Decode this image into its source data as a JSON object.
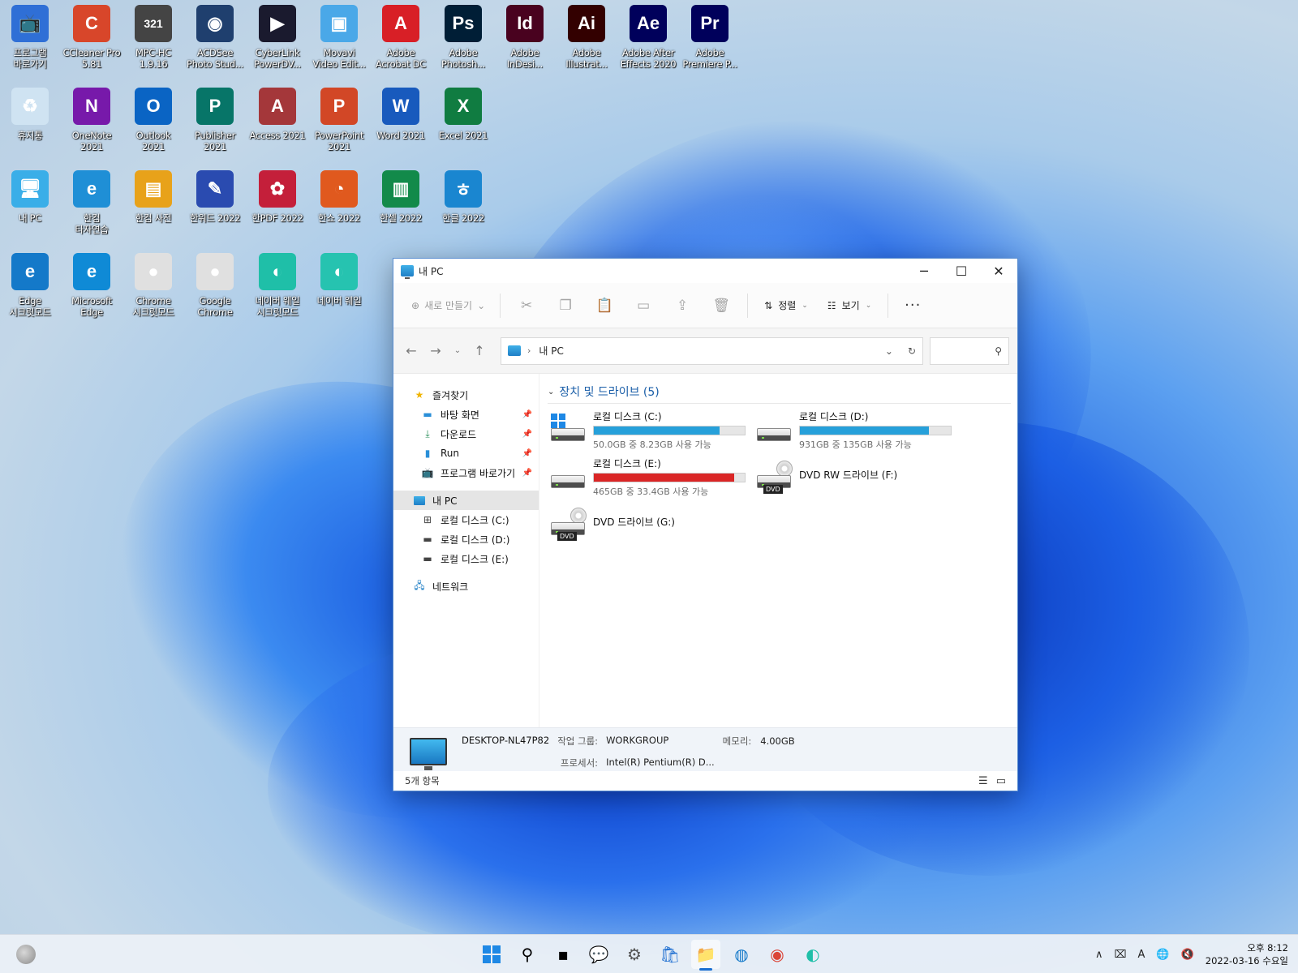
{
  "desktop": {
    "icons": [
      {
        "label": "프로그램\n바로가기",
        "glyph": "📺",
        "bg": "#2f6fd6"
      },
      {
        "label": "CCleaner Pro\n5.81",
        "glyph": "C",
        "bg": "#d8462a"
      },
      {
        "label": "MPC-HC\n1.9.16",
        "glyph": "321",
        "bg": "#444444"
      },
      {
        "label": "ACDSee\nPhoto Stud...",
        "glyph": "◉",
        "bg": "#1f3f6e"
      },
      {
        "label": "CyberLink\nPowerDV...",
        "glyph": "▶",
        "bg": "#1a1a2e"
      },
      {
        "label": "Movavi\nVideo Edit...",
        "glyph": "▣",
        "bg": "#4aa8e8"
      },
      {
        "label": "Adobe\nAcrobat DC",
        "glyph": "A",
        "bg": "#d81f26"
      },
      {
        "label": "Adobe\nPhotosh...",
        "glyph": "Ps",
        "bg": "#001e36"
      },
      {
        "label": "Adobe\nInDesi...",
        "glyph": "Id",
        "bg": "#49021f"
      },
      {
        "label": "Adobe\nIllustrat...",
        "glyph": "Ai",
        "bg": "#330000"
      },
      {
        "label": "Adobe After\nEffects 2020",
        "glyph": "Ae",
        "bg": "#00005b"
      },
      {
        "label": "Adobe\nPremiere P...",
        "glyph": "Pr",
        "bg": "#00005b"
      },
      {
        "label": "휴지통",
        "glyph": "♻",
        "bg": "#cfe3f2"
      },
      {
        "label": "OneNote\n2021",
        "glyph": "N",
        "bg": "#7719aa"
      },
      {
        "label": "Outlook\n2021",
        "glyph": "O",
        "bg": "#0a64c4"
      },
      {
        "label": "Publisher\n2021",
        "glyph": "P",
        "bg": "#077568"
      },
      {
        "label": "Access 2021",
        "glyph": "A",
        "bg": "#a4373a"
      },
      {
        "label": "PowerPoint\n2021",
        "glyph": "P",
        "bg": "#d24726"
      },
      {
        "label": "Word 2021",
        "glyph": "W",
        "bg": "#185abd"
      },
      {
        "label": "Excel 2021",
        "glyph": "X",
        "bg": "#107c41"
      },
      {
        "label": "내 PC",
        "glyph": "🖥",
        "bg": "#3aaee8"
      },
      {
        "label": "한컴\n타자연습",
        "glyph": "e",
        "bg": "#1f8fd6"
      },
      {
        "label": "한컴 사전",
        "glyph": "▤",
        "bg": "#e8a21a"
      },
      {
        "label": "한워드 2022",
        "glyph": "✎",
        "bg": "#2a4bb0"
      },
      {
        "label": "한PDF 2022",
        "glyph": "✿",
        "bg": "#c41f3a"
      },
      {
        "label": "한쇼 2022",
        "glyph": "◔",
        "bg": "#e0591e"
      },
      {
        "label": "한셀 2022",
        "glyph": "▥",
        "bg": "#128a4a"
      },
      {
        "label": "한글 2022",
        "glyph": "ㅎ",
        "bg": "#1a86d0"
      },
      {
        "label": "Edge\n시크릿모드",
        "glyph": "e",
        "bg": "#1479c9"
      },
      {
        "label": "Microsoft\nEdge",
        "glyph": "e",
        "bg": "#0f8ad6"
      },
      {
        "label": "Chrome\n시크릿모드",
        "glyph": "●",
        "bg": "#e0e0e0"
      },
      {
        "label": "Google\nChrome",
        "glyph": "●",
        "bg": "#e0e0e0"
      },
      {
        "label": "네이버 웨일\n시크릿모드",
        "glyph": "◐",
        "bg": "#1fbfa8"
      },
      {
        "label": "네이버 웨일",
        "glyph": "◐",
        "bg": "#26c3b0"
      }
    ]
  },
  "window": {
    "title": "내 PC",
    "toolbar": {
      "new_label": "새로 만들기",
      "sort_label": "정렬",
      "view_label": "보기",
      "more_label": "···"
    },
    "address": {
      "path": "내 PC",
      "search_placeholder": ""
    },
    "sidebar": {
      "quick_access": "즐겨찾기",
      "pinned": [
        {
          "label": "바탕 화면",
          "icon": "desktop-icon"
        },
        {
          "label": "다운로드",
          "icon": "download-icon"
        },
        {
          "label": "Run",
          "icon": "folder-icon"
        },
        {
          "label": "프로그램 바로가기",
          "icon": "tv-icon"
        }
      ],
      "this_pc": "내 PC",
      "drives": [
        {
          "label": "로컬 디스크 (C:)"
        },
        {
          "label": "로컬 디스크 (D:)"
        },
        {
          "label": "로컬 디스크 (E:)"
        }
      ],
      "network": "네트워크"
    },
    "group_title": "장치 및 드라이브 (5)",
    "drives": [
      {
        "name": "로컬 디스크 (C:)",
        "free": "50.0GB 중 8.23GB 사용 가능",
        "used_fraction": 0.835,
        "color": "#26a0da",
        "type": "system"
      },
      {
        "name": "로컬 디스크 (D:)",
        "free": "931GB 중 135GB 사용 가능",
        "used_fraction": 0.855,
        "color": "#26a0da",
        "type": "hdd"
      },
      {
        "name": "로컬 디스크 (E:)",
        "free": "465GB 중 33.4GB 사용 가능",
        "used_fraction": 0.928,
        "color": "#da2626",
        "type": "hdd"
      },
      {
        "name": "DVD RW 드라이브 (F:)",
        "type": "dvd"
      },
      {
        "name": "DVD 드라이브 (G:)",
        "type": "dvd"
      }
    ],
    "details": {
      "computer_name": "DESKTOP-NL47P82",
      "workgroup_label": "작업 그룹:",
      "workgroup": "WORKGROUP",
      "memory_label": "메모리:",
      "memory": "4.00GB",
      "processor_label": "프로세서:",
      "processor": "Intel(R) Pentium(R) D..."
    },
    "status": "5개 항목",
    "dvd_tag": "DVD"
  },
  "taskbar": {
    "clock_time": "오후 8:12",
    "clock_date": "2022-03-16 수요일",
    "ime": "A"
  }
}
